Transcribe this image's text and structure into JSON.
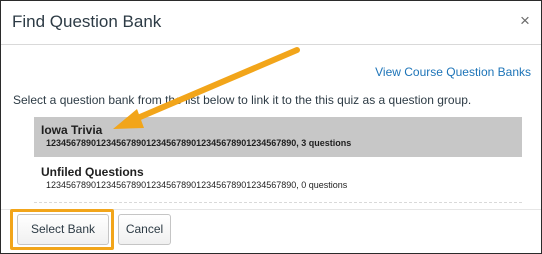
{
  "dialog": {
    "title": "Find Question Bank",
    "close_symbol": "×"
  },
  "view_banks_link": "View Course Question Banks",
  "instructions": "Select a question bank from the list below to link it to the this quiz as a question group.",
  "banks": [
    {
      "name": "Iowa Trivia",
      "meta": "12345678901234567890123456789012345678901234567890, 3 questions",
      "selected": true
    },
    {
      "name": "Unfiled Questions",
      "meta": "12345678901234567890123456789012345678901234567890, 0 questions",
      "selected": false
    }
  ],
  "buttons": {
    "select": "Select Bank",
    "cancel": "Cancel"
  },
  "annotation": {
    "highlight_color": "#f2a51a",
    "arrow_color": "#f2a51a"
  },
  "colors": {
    "link": "#1d74b8",
    "selected_row": "#c7c7c7"
  }
}
